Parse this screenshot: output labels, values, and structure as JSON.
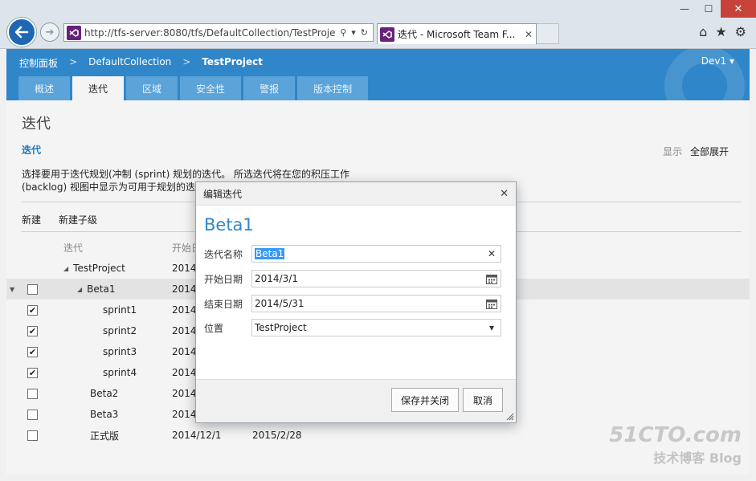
{
  "browser": {
    "url": "http://tfs-server:8080/tfs/DefaultCollection/TestProjec",
    "tab_title": "迭代 - Microsoft Team F...",
    "win_min": "—",
    "win_max": "☐",
    "win_close": "✕",
    "tab_close": "✕",
    "tools": [
      "⌂",
      "★",
      "⚙"
    ]
  },
  "header": {
    "breadcrumb": [
      "控制面板",
      "DefaultCollection",
      "TestProject"
    ],
    "separator": ">",
    "user": "Dev1 ▾",
    "tabs": [
      "概述",
      "迭代",
      "区域",
      "安全性",
      "警报",
      "版本控制"
    ],
    "active_tab_index": 1
  },
  "page": {
    "title": "迭代",
    "section": "迭代",
    "display_label": "显示",
    "display_value": "全部展开",
    "description_line1": "选择要用于迭代规划(冲制 (sprint) 规划的迭代。 所选迭代将在您的积压工作",
    "description_line2": "(backlog) 视图中显示为可用于规划的迭代。",
    "toolbar": {
      "new": "新建",
      "new_child": "新建子级"
    },
    "grid": {
      "headers": {
        "name": "迭代",
        "start": "开始日"
      },
      "rows": [
        {
          "name": "TestProject",
          "start": "2014/",
          "end": "",
          "level": 0,
          "checkbox": false,
          "checked": false,
          "expander": "◢",
          "selected": false,
          "row_arrow": ""
        },
        {
          "name": "Beta1",
          "start": "2014/",
          "end": "",
          "level": 1,
          "checkbox": true,
          "checked": false,
          "expander": "◢",
          "selected": true,
          "row_arrow": "▼"
        },
        {
          "name": "sprint1",
          "start": "2014/",
          "end": "",
          "level": 2,
          "checkbox": true,
          "checked": true,
          "expander": "",
          "selected": false,
          "row_arrow": ""
        },
        {
          "name": "sprint2",
          "start": "2014/",
          "end": "",
          "level": 2,
          "checkbox": true,
          "checked": true,
          "expander": "",
          "selected": false,
          "row_arrow": ""
        },
        {
          "name": "sprint3",
          "start": "2014/",
          "end": "",
          "level": 2,
          "checkbox": true,
          "checked": true,
          "expander": "",
          "selected": false,
          "row_arrow": ""
        },
        {
          "name": "sprint4",
          "start": "2014/",
          "end": "",
          "level": 2,
          "checkbox": true,
          "checked": true,
          "expander": "",
          "selected": false,
          "row_arrow": ""
        },
        {
          "name": "Beta2",
          "start": "2014/",
          "end": "",
          "level": 1,
          "checkbox": true,
          "checked": false,
          "expander": "",
          "selected": false,
          "row_arrow": ""
        },
        {
          "name": "Beta3",
          "start": "2014/",
          "end": "",
          "level": 1,
          "checkbox": true,
          "checked": false,
          "expander": "",
          "selected": false,
          "row_arrow": ""
        },
        {
          "name": "正式版",
          "start": "2014/12/1",
          "end": "2015/2/28",
          "level": 1,
          "checkbox": true,
          "checked": false,
          "expander": "",
          "selected": false,
          "row_arrow": ""
        }
      ],
      "check_mark": "✔"
    }
  },
  "dialog": {
    "title": "编辑迭代",
    "close": "✕",
    "heading": "Beta1",
    "fields": {
      "name": {
        "label": "迭代名称",
        "value": "Beta1",
        "clear": "✕"
      },
      "start": {
        "label": "开始日期",
        "value": "2014/3/1"
      },
      "end": {
        "label": "结束日期",
        "value": "2014/5/31"
      },
      "location": {
        "label": "位置",
        "value": "TestProject",
        "caret": "▾"
      }
    },
    "save_close": "保存并关闭",
    "cancel": "取消"
  },
  "watermark": {
    "brand": "51CTO.com",
    "sub": "技术博客 Blog"
  },
  "colors": {
    "accent": "#2f86c9",
    "tab": "#5ba3d8",
    "link": "#1e79c0",
    "close": "#c7433a"
  }
}
